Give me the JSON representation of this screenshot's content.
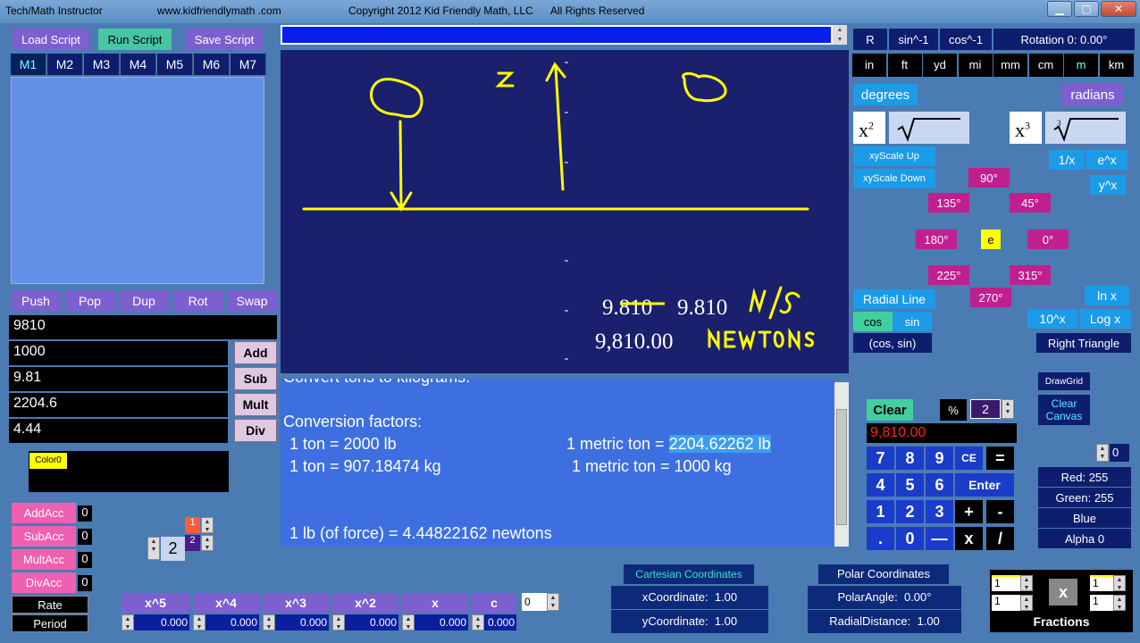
{
  "window": {
    "title": "Tech/Math Instructor",
    "website": "www.kidfriendlymath .com",
    "copyright": "Copyright 2012 Kid Friendly Math, LLC",
    "rights": "All Rights Reserved",
    "min_glyph": "▁",
    "max_glyph": "▢",
    "close_glyph": "✕"
  },
  "script": {
    "load": "Load Script",
    "run": "Run Script",
    "save": "Save Script"
  },
  "memory_tabs": [
    "M1",
    "M2",
    "M3",
    "M4",
    "M5",
    "M6",
    "M7"
  ],
  "stack_ops": [
    "Push",
    "Pop",
    "Dup",
    "Rot",
    "Swap"
  ],
  "stack": [
    "9810",
    "1000",
    "9.81",
    "2204.6",
    "4.44"
  ],
  "arith": [
    "Add",
    "Sub",
    "Mult",
    "Div"
  ],
  "color_label": "Color0",
  "accumulators": [
    {
      "label": "AddAcc",
      "value": "0"
    },
    {
      "label": "SubAcc",
      "value": "0"
    },
    {
      "label": "MultAcc",
      "value": "0"
    },
    {
      "label": "DivAcc",
      "value": "0"
    }
  ],
  "rate_label": "Rate",
  "period_label": "Period",
  "spinner_big": "2",
  "spinner_small_1": "1",
  "spinner_small_2": "2",
  "poly": {
    "terms": [
      "x^5",
      "x^4",
      "x^3",
      "x^2",
      "x",
      "c"
    ],
    "values": [
      "0.000",
      "0.000",
      "0.000",
      "0.000",
      "0.000",
      "0.000"
    ],
    "degree": "0"
  },
  "canvas": {
    "label_z": "Z",
    "value1_struck": "9.810",
    "value1": "9.810",
    "unit1": "m/s²",
    "value2": "9,810.00",
    "unit2": "NEWTONS"
  },
  "notes": {
    "cut_line": "Convert tons to kilograms:",
    "heading": "Conversion factors:",
    "line1_left": "1 ton = 2000 lb",
    "line1_right_pre": "1 metric ton = ",
    "line1_right_sel": "2204.62262 lb",
    "line2_left": "1 ton = 907.18474 kg",
    "line2_right": "1 metric ton = 1000 kg",
    "line3": "1 lb (of force) = 4.44822162 newtons"
  },
  "trig": {
    "r": "R",
    "asin": "sin^-1",
    "acos": "cos^-1",
    "rotation": "Rotation 0:  0.00°"
  },
  "units": [
    "in",
    "ft",
    "yd",
    "mi",
    "mm",
    "cm",
    "m",
    "km"
  ],
  "modes": {
    "degrees": "degrees",
    "radians": "radians"
  },
  "powers": {
    "x2": "x",
    "x2_exp": "2",
    "x3": "x",
    "x3_exp": "3",
    "root3_index": "3"
  },
  "scale": {
    "up": "xyScale Up",
    "down": "xyScale Down"
  },
  "funcs": {
    "inv": "1/x",
    "exp": "e^x",
    "yx": "y^x",
    "ln": "ln x",
    "ten": "10^x",
    "log": "Log x"
  },
  "angles": {
    "a90": "90°",
    "a135": "135°",
    "a45": "45°",
    "a180": "180°",
    "e": "e",
    "a0": "0°",
    "a225": "225°",
    "a315": "315°",
    "a270": "270°"
  },
  "radial": {
    "line": "Radial Line",
    "cos": "cos",
    "sin": "sin",
    "pair": "(cos, sin)"
  },
  "right_triangle": "Right Triangle",
  "calculator": {
    "clear": "Clear",
    "percent": "%",
    "precision": "2",
    "display": "9,810.00",
    "keys_row1": [
      "7",
      "8",
      "9",
      "CE",
      "="
    ],
    "keys_row2": [
      "4",
      "5",
      "6",
      "Enter"
    ],
    "keys_row3": [
      "1",
      "2",
      "3",
      "+",
      "-"
    ],
    "keys_row4": [
      ".",
      "0",
      "—",
      "x",
      "/"
    ]
  },
  "draw": {
    "grid": "DrawGrid",
    "clear": "Clear Canvas"
  },
  "color": {
    "spin_val": "0",
    "red_label": "Red:",
    "red": "255",
    "green_label": "Green:",
    "green": "255",
    "blue_label": "Blue",
    "alpha_label": "Alpha",
    "alpha": "0"
  },
  "cartesian": {
    "title": "Cartesian Coordinates",
    "x_label": "xCoordinate:",
    "x": "1.00",
    "y_label": "yCoordinate:",
    "y": "1.00"
  },
  "polar": {
    "title": "Polar Coordinates",
    "angle_label": "PolarAngle:",
    "angle": "0.00°",
    "dist_label": "RadialDistance:",
    "dist": "1.00"
  },
  "fractions": {
    "label": "Fractions",
    "n1": "1",
    "d1": "1",
    "n2": "1",
    "d2": "1",
    "op": "x"
  },
  "colors": {
    "canvas": "#1a1f6e",
    "ink": "#ffff00",
    "notes": "#3e6fe0"
  }
}
